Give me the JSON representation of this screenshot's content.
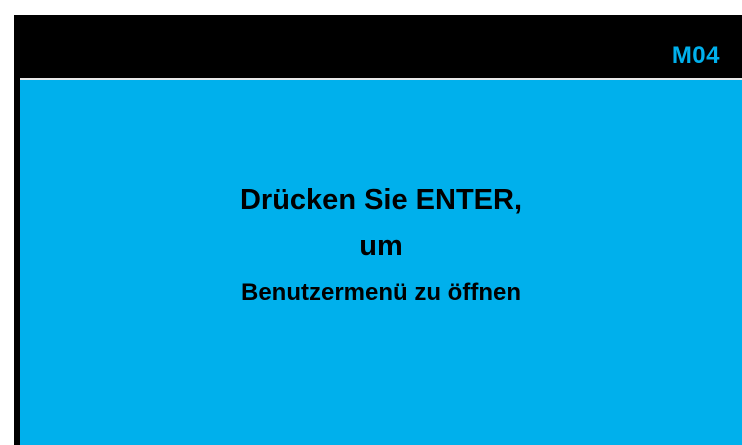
{
  "header": {
    "screen_code": "M04"
  },
  "message": {
    "line1": "Drücken Sie ENTER,",
    "line2": "um",
    "line3": "Benutzermenü zu öffnen"
  },
  "colors": {
    "background": "#00b0ec",
    "header": "#000000",
    "text": "#000000",
    "code_text": "#00b0ec"
  }
}
